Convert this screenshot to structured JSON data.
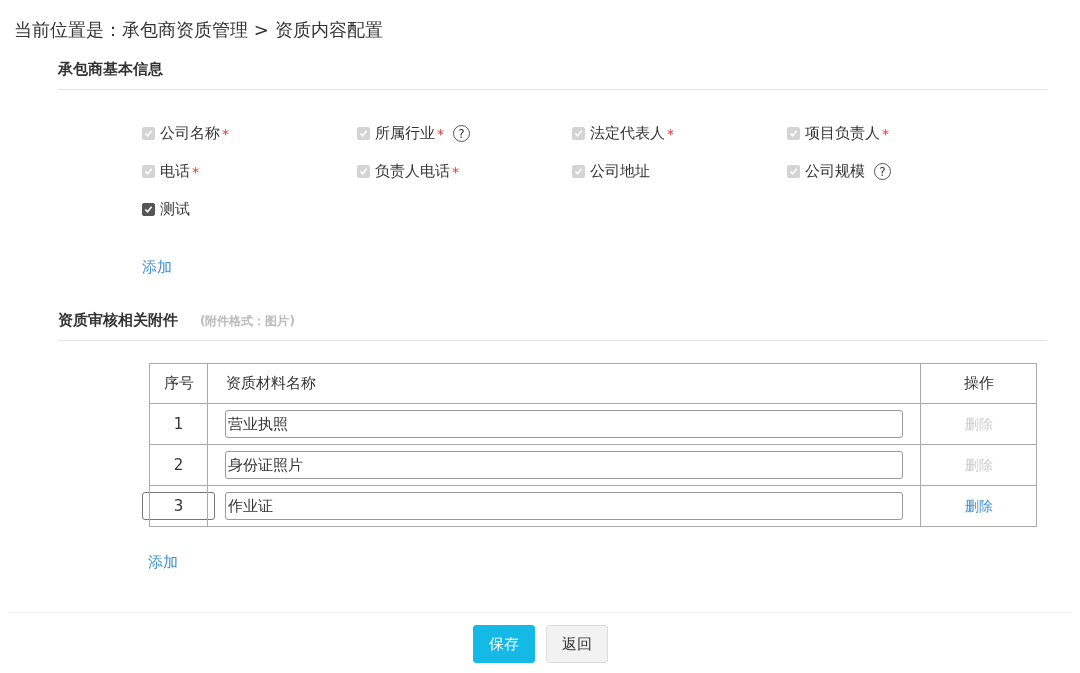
{
  "breadcrumb": "当前位置是：承包商资质管理 > 资质内容配置",
  "basic_info": {
    "title": "承包商基本信息",
    "fields": [
      {
        "label": "公司名称",
        "checked": true,
        "disabled": true,
        "required": true,
        "help": false
      },
      {
        "label": "所属行业",
        "checked": true,
        "disabled": true,
        "required": true,
        "help": true
      },
      {
        "label": "法定代表人",
        "checked": true,
        "disabled": true,
        "required": true,
        "help": false
      },
      {
        "label": "项目负责人",
        "checked": true,
        "disabled": true,
        "required": true,
        "help": false
      },
      {
        "label": "电话",
        "checked": true,
        "disabled": true,
        "required": true,
        "help": false
      },
      {
        "label": "负责人电话",
        "checked": true,
        "disabled": true,
        "required": true,
        "help": false
      },
      {
        "label": "公司地址",
        "checked": true,
        "disabled": true,
        "required": false,
        "help": false
      },
      {
        "label": "公司规模",
        "checked": true,
        "disabled": true,
        "required": false,
        "help": true
      },
      {
        "label": "测试",
        "checked": true,
        "disabled": false,
        "required": false,
        "help": false
      }
    ],
    "required_mark": "*",
    "help_mark": "?",
    "add_link": "添加"
  },
  "attachments": {
    "title": "资质审核相关附件",
    "note": "(附件格式：图片)",
    "columns": [
      "序号",
      "资质材料名称",
      "操作"
    ],
    "rows": [
      {
        "index": "1",
        "name": "营业执照",
        "action": "删除",
        "action_disabled": true,
        "focused": false
      },
      {
        "index": "2",
        "name": "身份证照片",
        "action": "删除",
        "action_disabled": true,
        "focused": false
      },
      {
        "index": "3",
        "name": "作业证",
        "action": "删除",
        "action_disabled": false,
        "focused": true
      }
    ],
    "add_link": "添加"
  },
  "buttons": [
    {
      "label": "保存",
      "kind": "primary"
    },
    {
      "label": "返回",
      "kind": "secondary"
    }
  ]
}
